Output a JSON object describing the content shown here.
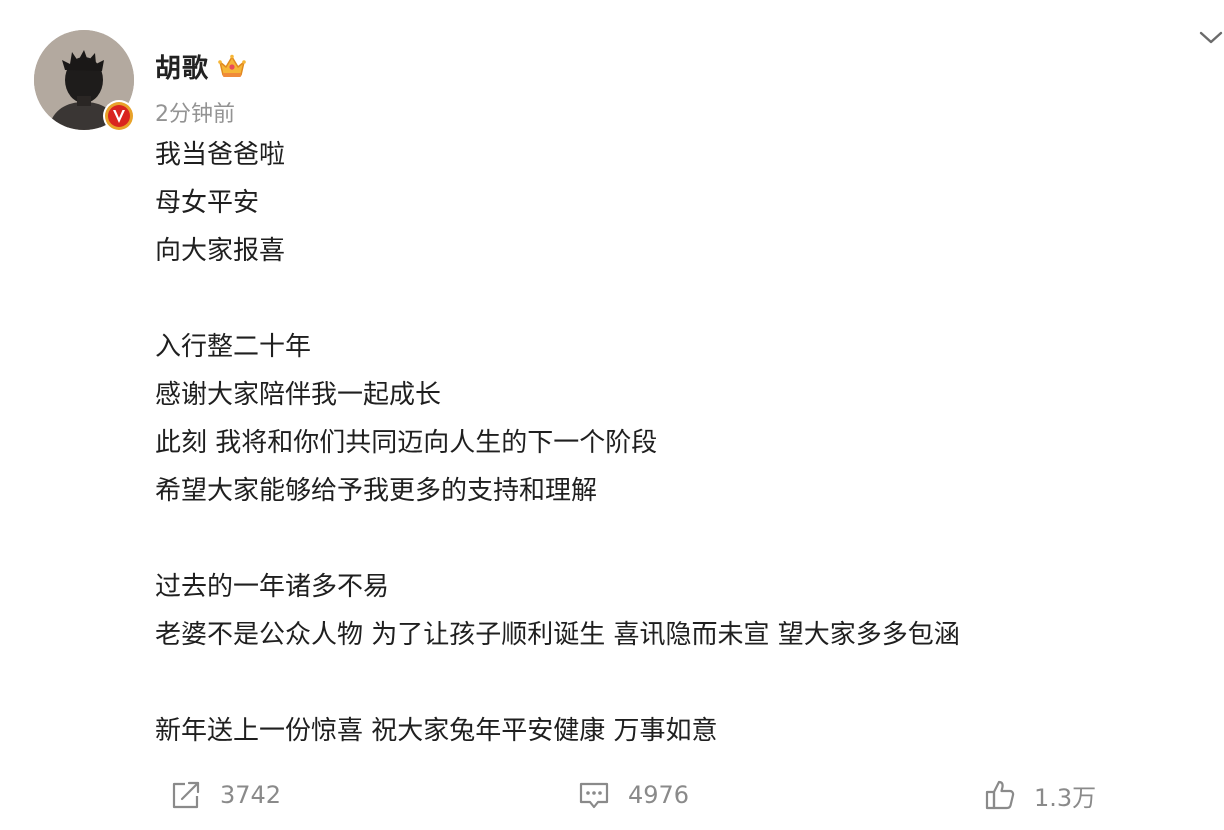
{
  "user": {
    "name": "胡歌",
    "avatar_icon": "avatar-photo",
    "verified_icon": "verified-v-badge",
    "crown_icon": "crown-icon",
    "time": "2分钟前"
  },
  "menu_icon": "chevron-down-icon",
  "content": {
    "lines": [
      "我当爸爸啦",
      "母女平安",
      "向大家报喜",
      "",
      "入行整二十年",
      "感谢大家陪伴我一起成长",
      "此刻 我将和你们共同迈向人生的下一个阶段",
      "希望大家能够给予我更多的支持和理解",
      "",
      "过去的一年诸多不易",
      "老婆不是公众人物 为了让孩子顺利诞生 喜讯隐而未宣 望大家多多包涵",
      "",
      "新年送上一份惊喜 祝大家兔年平安健康 万事如意"
    ]
  },
  "actions": {
    "repost": {
      "icon": "share-icon",
      "count": "3742"
    },
    "comment": {
      "icon": "comment-icon",
      "count": "4976"
    },
    "like": {
      "icon": "thumbs-up-icon",
      "count": "1.3万"
    }
  },
  "colors": {
    "text": "#1f1f1f",
    "meta": "#939393",
    "action": "#8a8a8a",
    "verified": "#e8a22a",
    "verified_inner": "#d9241f"
  }
}
